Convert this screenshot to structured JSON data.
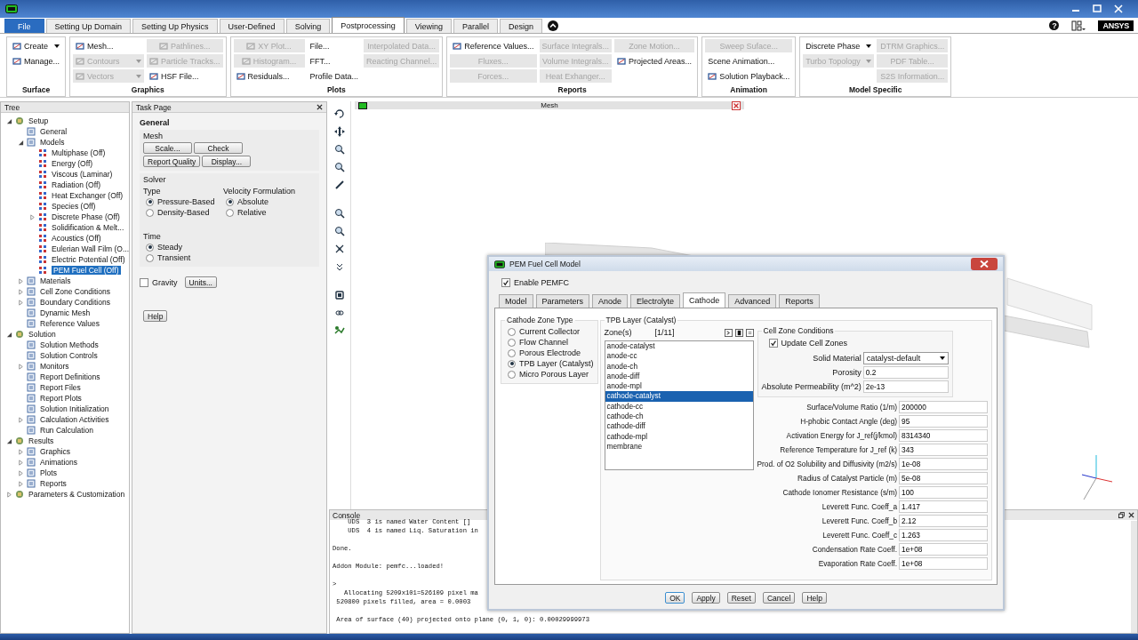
{
  "window": {
    "help_glyph": "?",
    "logo": "ANSYS"
  },
  "menu_tabs": [
    {
      "label": "File",
      "kind": "file",
      "selected": false
    },
    {
      "label": "Setting Up Domain",
      "kind": "tab",
      "selected": false
    },
    {
      "label": "Setting Up Physics",
      "kind": "tab",
      "selected": false
    },
    {
      "label": "User-Defined",
      "kind": "tab",
      "selected": false
    },
    {
      "label": "Solving",
      "kind": "tab",
      "selected": false
    },
    {
      "label": "Postprocessing",
      "kind": "tab",
      "selected": true
    },
    {
      "label": "Viewing",
      "kind": "tab",
      "selected": false
    },
    {
      "label": "Parallel",
      "kind": "tab",
      "selected": false
    },
    {
      "label": "Design",
      "kind": "tab",
      "selected": false
    }
  ],
  "ribbon": {
    "groups": [
      {
        "title": "Surface",
        "columns": [
          [
            {
              "label": "Create",
              "disabled": false,
              "icon": true,
              "dropdown": true
            },
            {
              "label": "Manage...",
              "disabled": false,
              "icon": true,
              "dropdown": false
            }
          ]
        ]
      },
      {
        "title": "Graphics",
        "columns": [
          [
            {
              "label": "Mesh...",
              "disabled": false,
              "icon": true,
              "dropdown": false
            },
            {
              "label": "Contours",
              "disabled": true,
              "icon": true,
              "dropdown": true
            },
            {
              "label": "Vectors",
              "disabled": true,
              "icon": true,
              "dropdown": true
            }
          ],
          [
            {
              "label": "Pathlines...",
              "disabled": true,
              "icon": true,
              "dropdown": false
            },
            {
              "label": "Particle Tracks...",
              "disabled": true,
              "icon": true,
              "dropdown": false
            },
            {
              "label": "HSF File...",
              "disabled": false,
              "icon": true,
              "dropdown": false
            }
          ]
        ]
      },
      {
        "title": "Plots",
        "columns": [
          [
            {
              "label": "XY Plot...",
              "disabled": true,
              "icon": true,
              "dropdown": false
            },
            {
              "label": "Histogram...",
              "disabled": true,
              "icon": true,
              "dropdown": false
            },
            {
              "label": "Residuals...",
              "disabled": false,
              "icon": true,
              "dropdown": false
            }
          ],
          [
            {
              "label": "File...",
              "disabled": false,
              "icon": false,
              "dropdown": false
            },
            {
              "label": "FFT...",
              "disabled": false,
              "icon": false,
              "dropdown": false
            },
            {
              "label": "Profile Data...",
              "disabled": false,
              "icon": false,
              "dropdown": false
            }
          ],
          [
            {
              "label": "Interpolated Data...",
              "disabled": true,
              "icon": false,
              "dropdown": false
            },
            {
              "label": "Reacting Channel...",
              "disabled": true,
              "icon": false,
              "dropdown": false
            }
          ]
        ]
      },
      {
        "title": "Reports",
        "columns": [
          [
            {
              "label": "Reference Values...",
              "disabled": false,
              "icon": true,
              "dropdown": false
            },
            {
              "label": "Fluxes...",
              "disabled": true,
              "icon": false,
              "dropdown": false
            },
            {
              "label": "Forces...",
              "disabled": true,
              "icon": false,
              "dropdown": false
            }
          ],
          [
            {
              "label": "Surface Integrals...",
              "disabled": true,
              "icon": false,
              "dropdown": false
            },
            {
              "label": "Volume Integrals...",
              "disabled": true,
              "icon": false,
              "dropdown": false
            },
            {
              "label": "Heat Exhanger...",
              "disabled": true,
              "icon": false,
              "dropdown": false
            }
          ],
          [
            {
              "label": "Zone Motion...",
              "disabled": true,
              "icon": false,
              "dropdown": false
            },
            {
              "label": "Projected Areas...",
              "disabled": false,
              "icon": true,
              "dropdown": false
            }
          ]
        ]
      },
      {
        "title": "Animation",
        "columns": [
          [
            {
              "label": "Sweep Suface...",
              "disabled": true,
              "icon": false,
              "dropdown": false
            },
            {
              "label": "Scene Animation...",
              "disabled": false,
              "icon": false,
              "dropdown": false
            },
            {
              "label": "Solution Playback...",
              "disabled": false,
              "icon": true,
              "dropdown": false
            }
          ]
        ]
      },
      {
        "title": "Model Specific",
        "columns": [
          [
            {
              "label": "Discrete Phase",
              "disabled": false,
              "icon": false,
              "dropdown": true
            },
            {
              "label": "Turbo Topology",
              "disabled": true,
              "icon": false,
              "dropdown": true
            }
          ],
          [
            {
              "label": "DTRM Graphics...",
              "disabled": true,
              "icon": false,
              "dropdown": false
            },
            {
              "label": "PDF Table...",
              "disabled": true,
              "icon": false,
              "dropdown": false
            },
            {
              "label": "S2S Information...",
              "disabled": true,
              "icon": false,
              "dropdown": false
            }
          ]
        ]
      }
    ]
  },
  "tree": {
    "title": "Tree",
    "items": [
      {
        "label": "Setup",
        "expanded": true,
        "selected": false,
        "children": [
          {
            "label": "General",
            "selected": false
          },
          {
            "label": "Models",
            "expanded": true,
            "selected": false,
            "children": [
              {
                "label": "Multiphase (Off)",
                "selected": false
              },
              {
                "label": "Energy (Off)",
                "selected": false
              },
              {
                "label": "Viscous (Laminar)",
                "selected": false
              },
              {
                "label": "Radiation (Off)",
                "selected": false
              },
              {
                "label": "Heat Exchanger (Off)",
                "selected": false
              },
              {
                "label": "Species (Off)",
                "selected": false
              },
              {
                "label": "Discrete Phase (Off)",
                "expanded": false,
                "selected": false
              },
              {
                "label": "Solidification & Melt...",
                "selected": false
              },
              {
                "label": "Acoustics (Off)",
                "selected": false
              },
              {
                "label": "Eulerian Wall Film (O...",
                "selected": false
              },
              {
                "label": "Electric Potential (Off)",
                "selected": false
              },
              {
                "label": "PEM Fuel Cell (Off)",
                "selected": true
              }
            ]
          },
          {
            "label": "Materials",
            "expanded": false,
            "selected": false
          },
          {
            "label": "Cell Zone Conditions",
            "expanded": false,
            "selected": false
          },
          {
            "label": "Boundary Conditions",
            "expanded": false,
            "selected": false
          },
          {
            "label": "Dynamic Mesh",
            "selected": false
          },
          {
            "label": "Reference Values",
            "selected": false
          }
        ]
      },
      {
        "label": "Solution",
        "expanded": true,
        "selected": false,
        "children": [
          {
            "label": "Solution Methods",
            "selected": false
          },
          {
            "label": "Solution Controls",
            "selected": false
          },
          {
            "label": "Monitors",
            "expanded": false,
            "selected": false
          },
          {
            "label": "Report Definitions",
            "selected": false
          },
          {
            "label": "Report Files",
            "selected": false
          },
          {
            "label": "Report Plots",
            "selected": false
          },
          {
            "label": "Solution Initialization",
            "selected": false
          },
          {
            "label": "Calculation Activities",
            "expanded": false,
            "selected": false
          },
          {
            "label": "Run Calculation",
            "selected": false
          }
        ]
      },
      {
        "label": "Results",
        "expanded": true,
        "selected": false,
        "children": [
          {
            "label": "Graphics",
            "expanded": false,
            "selected": false
          },
          {
            "label": "Animations",
            "expanded": false,
            "selected": false
          },
          {
            "label": "Plots",
            "expanded": false,
            "selected": false
          },
          {
            "label": "Reports",
            "expanded": false,
            "selected": false
          }
        ]
      },
      {
        "label": "Parameters & Customization",
        "expanded": false,
        "selected": false
      }
    ]
  },
  "task_page": {
    "title": "Task Page",
    "heading": "General",
    "mesh_title": "Mesh",
    "mesh_buttons": [
      "Scale...",
      "Check",
      "Report Quality",
      "Display..."
    ],
    "solver_title": "Solver",
    "type": {
      "title": "Type",
      "options": [
        {
          "label": "Pressure-Based",
          "selected": true
        },
        {
          "label": "Density-Based",
          "selected": false
        }
      ]
    },
    "velocity": {
      "title": "Velocity Formulation",
      "options": [
        {
          "label": "Absolute",
          "selected": true
        },
        {
          "label": "Relative",
          "selected": false
        }
      ]
    },
    "time": {
      "title": "Time",
      "options": [
        {
          "label": "Steady",
          "selected": true
        },
        {
          "label": "Transient",
          "selected": false
        }
      ]
    },
    "gravity": {
      "label": "Gravity",
      "checked": false
    },
    "units_button": "Units...",
    "help_button": "Help"
  },
  "graphics": {
    "title": "Mesh"
  },
  "console": {
    "title": "Console",
    "blocks": [
      [
        "    UDS  3 is named Water Content []",
        "    UDS  4 is named Liq. Saturation in"
      ],
      [
        "Done."
      ],
      [
        "Addon Module: pemfc...loaded!"
      ],
      [
        ">",
        "   Allocating 5209x101=526109 pixel ma",
        " 520800 pixels filled, area = 0.0003"
      ],
      [
        " Area of surface (40) projected onto plane (0, 1, 0): 0.00029999973"
      ]
    ]
  },
  "dialog": {
    "title": "PEM Fuel Cell Model",
    "enable": {
      "label": "Enable PEMFC",
      "checked": true
    },
    "tabs": [
      {
        "label": "Model",
        "selected": false
      },
      {
        "label": "Parameters",
        "selected": false
      },
      {
        "label": "Anode",
        "selected": false
      },
      {
        "label": "Electrolyte",
        "selected": false
      },
      {
        "label": "Cathode",
        "selected": true
      },
      {
        "label": "Advanced",
        "selected": false
      },
      {
        "label": "Reports",
        "selected": false
      }
    ],
    "zone_type": {
      "title": "Cathode Zone Type",
      "options": [
        {
          "label": "Current Collector",
          "selected": false
        },
        {
          "label": "Flow Channel",
          "selected": false
        },
        {
          "label": "Porous Electrode",
          "selected": false
        },
        {
          "label": "TPB Layer (Catalyst)",
          "selected": true
        },
        {
          "label": "Micro Porous Layer",
          "selected": false
        }
      ]
    },
    "layer": {
      "title": "TPB Layer (Catalyst)",
      "zones_label": "Zone(s)",
      "count": "[1/11]",
      "zones": [
        {
          "label": "anode-catalyst",
          "selected": false
        },
        {
          "label": "anode-cc",
          "selected": false
        },
        {
          "label": "anode-ch",
          "selected": false
        },
        {
          "label": "anode-diff",
          "selected": false
        },
        {
          "label": "anode-mpl",
          "selected": false
        },
        {
          "label": "cathode-catalyst",
          "selected": true
        },
        {
          "label": "cathode-cc",
          "selected": false
        },
        {
          "label": "cathode-ch",
          "selected": false
        },
        {
          "label": "cathode-diff",
          "selected": false
        },
        {
          "label": "cathode-mpl",
          "selected": false
        },
        {
          "label": "membrane",
          "selected": false
        }
      ]
    },
    "cell_zone": {
      "title": "Cell Zone Conditions",
      "update": {
        "label": "Update Cell Zones",
        "checked": true
      },
      "material_label": "Solid Material",
      "material": "catalyst-default",
      "fields": [
        {
          "label": "Porosity",
          "value": "0.2"
        },
        {
          "label": "Absolute Permeability (m^2)",
          "value": "2e-13"
        }
      ]
    },
    "fields": [
      {
        "label": "Surface/Volume Ratio (1/m)",
        "value": "200000"
      },
      {
        "label": "H-phobic Contact Angle (deg)",
        "value": "95"
      },
      {
        "label": "Activation Energy for J_ref(j/kmol)",
        "value": "8314340"
      },
      {
        "label": "Reference Temperature for J_ref (k)",
        "value": "343"
      },
      {
        "label": "Prod. of O2 Solubility and Diffusivity (m2/s)",
        "value": "1e-08"
      },
      {
        "label": "Radius of Catalyst Particle (m)",
        "value": "5e-08"
      },
      {
        "label": "Cathode Ionomer Resistance (s/m)",
        "value": "100"
      },
      {
        "label": "Leverett Func. Coeff_a",
        "value": "1.417"
      },
      {
        "label": "Leverett Func. Coeff_b",
        "value": "2.12"
      },
      {
        "label": "Leverett Func. Coeff_c",
        "value": "1.263"
      },
      {
        "label": "Condensation Rate Coeff.",
        "value": "1e+08"
      },
      {
        "label": "Evaporation Rate Coeff.",
        "value": "1e+08"
      }
    ],
    "buttons": [
      "OK",
      "Apply",
      "Reset",
      "Cancel",
      "Help"
    ]
  }
}
